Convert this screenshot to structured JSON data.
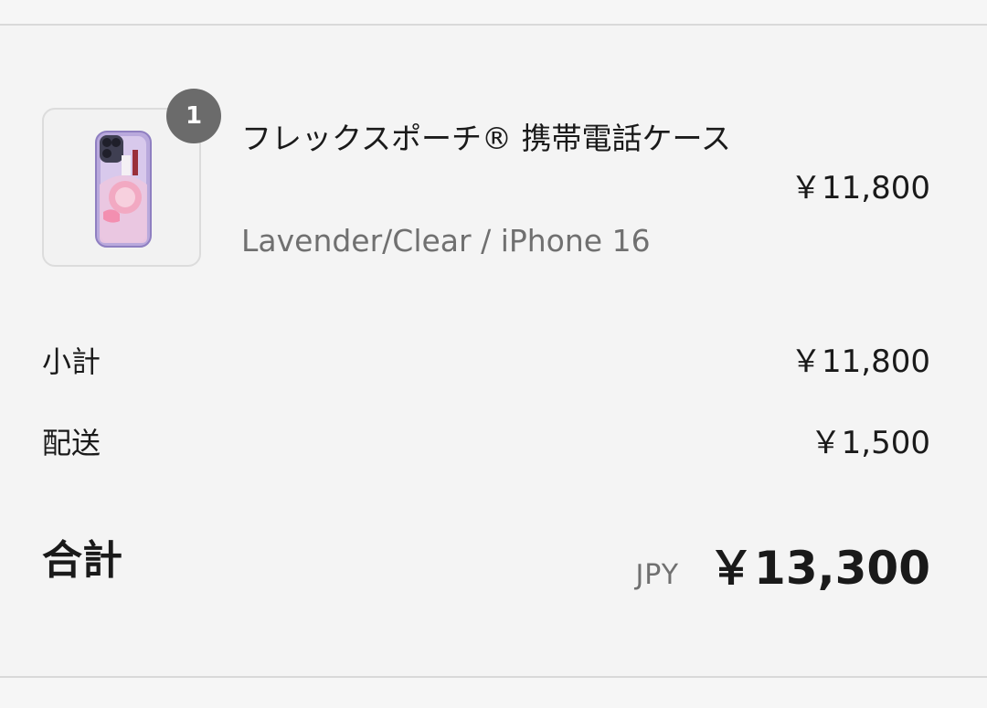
{
  "line_item": {
    "quantity": "1",
    "title": "フレックスポーチ® 携帯電話ケース",
    "variant": "Lavender/Clear / iPhone 16",
    "price": "￥11,800",
    "image_icon": "phone-case-thumbnail"
  },
  "summary": {
    "subtotal_label": "小計",
    "subtotal_value": "￥11,800",
    "shipping_label": "配送",
    "shipping_value": "￥1,500",
    "total_label": "合計",
    "currency_code": "JPY",
    "total_value": "￥13,300"
  },
  "colors": {
    "background": "#f4f4f4",
    "badge": "#6b6b6b",
    "secondary_text": "#707070",
    "divider": "#d9d9d9"
  }
}
